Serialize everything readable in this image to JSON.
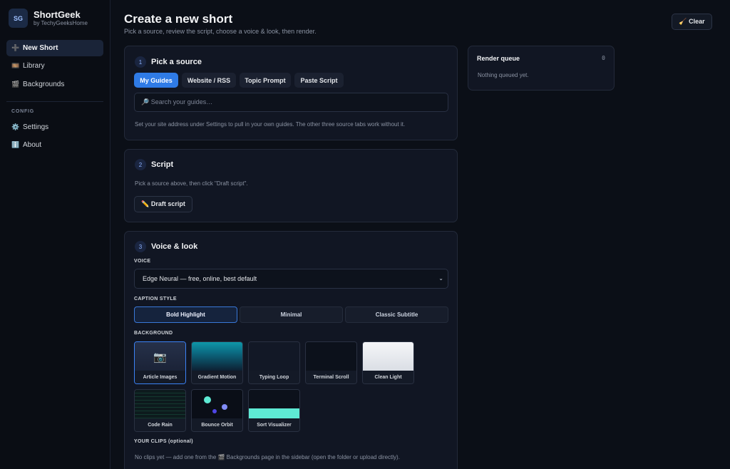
{
  "sidebar": {
    "logo": "SG",
    "brand_name": "ShortGeek",
    "brand_sub": "by TechyGeeksHome",
    "items": [
      {
        "icon": "➕",
        "label": "New Short"
      },
      {
        "icon": "🎞️",
        "label": "Library"
      },
      {
        "icon": "🎬",
        "label": "Backgrounds"
      }
    ],
    "config_label": "CONFIG",
    "config_items": [
      {
        "icon": "⚙️",
        "label": "Settings"
      },
      {
        "icon": "ℹ️",
        "label": "About"
      }
    ]
  },
  "header": {
    "title": "Create a new short",
    "subtitle": "Pick a source, review the script, choose a voice & look, then render.",
    "clear_label": "🧹 Clear"
  },
  "step1": {
    "num": "1",
    "title": "Pick a source",
    "tabs": [
      "My Guides",
      "Website / RSS",
      "Topic Prompt",
      "Paste Script"
    ],
    "search_placeholder": "🔎 Search your guides…",
    "hint": "Set your site address under Settings to pull in your own guides. The other three source tabs work without it."
  },
  "step2": {
    "num": "2",
    "title": "Script",
    "hint": "Pick a source above, then click \"Draft script\".",
    "draft_label": "✏️ Draft script"
  },
  "step3": {
    "num": "3",
    "title": "Voice & look",
    "voice_label": "VOICE",
    "voice_value": "Edge Neural — free, online, best default",
    "caption_label": "CAPTION STYLE",
    "caption_styles": [
      "Bold Highlight",
      "Minimal",
      "Classic Subtitle"
    ],
    "background_label": "BACKGROUND",
    "backgrounds": [
      "Article Images",
      "Gradient Motion",
      "Typing Loop",
      "Terminal Scroll",
      "Clean Light",
      "Code Rain",
      "Bounce Orbit",
      "Sort Visualizer"
    ],
    "clips_label": "YOUR CLIPS (optional)",
    "clips_hint": "No clips yet — add one from the 🎬 Backgrounds page in the sidebar (open the folder or upload directly)."
  },
  "queue": {
    "title": "Render queue",
    "count": "0",
    "empty": "Nothing queued yet."
  }
}
